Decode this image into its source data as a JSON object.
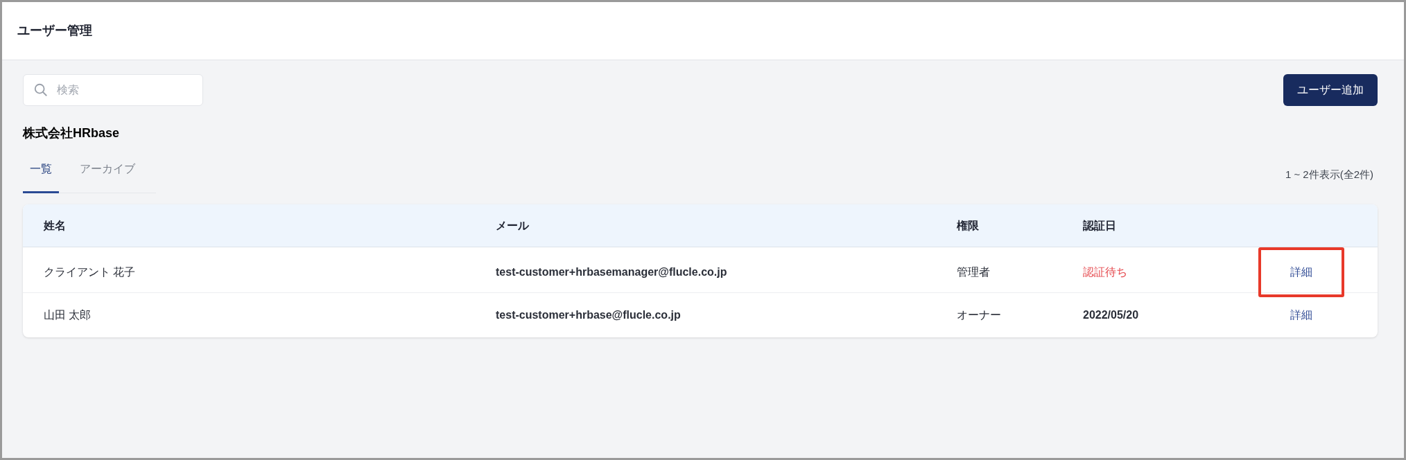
{
  "header": {
    "title": "ユーザー管理"
  },
  "search": {
    "placeholder": "検索"
  },
  "add_button": "ユーザー追加",
  "company": "株式会社HRbase",
  "tabs": [
    {
      "label": "一覧",
      "selected": true
    },
    {
      "label": "アーカイブ",
      "selected": false
    }
  ],
  "count": "1 ~ 2件表示(全2件)",
  "table": {
    "columns": [
      "姓名",
      "メール",
      "権限",
      "認証日"
    ],
    "rows": [
      {
        "name": "クライアント 花子",
        "email": "test-customer+hrbasemanager@flucle.co.jp",
        "role": "管理者",
        "verified": {
          "kind": "pending",
          "text": "認証待ち"
        },
        "action": "詳細",
        "highlighted": true
      },
      {
        "name": "山田 太郎",
        "email": "test-customer+hrbase@flucle.co.jp",
        "role": "オーナー",
        "verified": {
          "kind": "date",
          "text": "2022/05/20"
        },
        "action": "詳細",
        "highlighted": false
      }
    ]
  }
}
